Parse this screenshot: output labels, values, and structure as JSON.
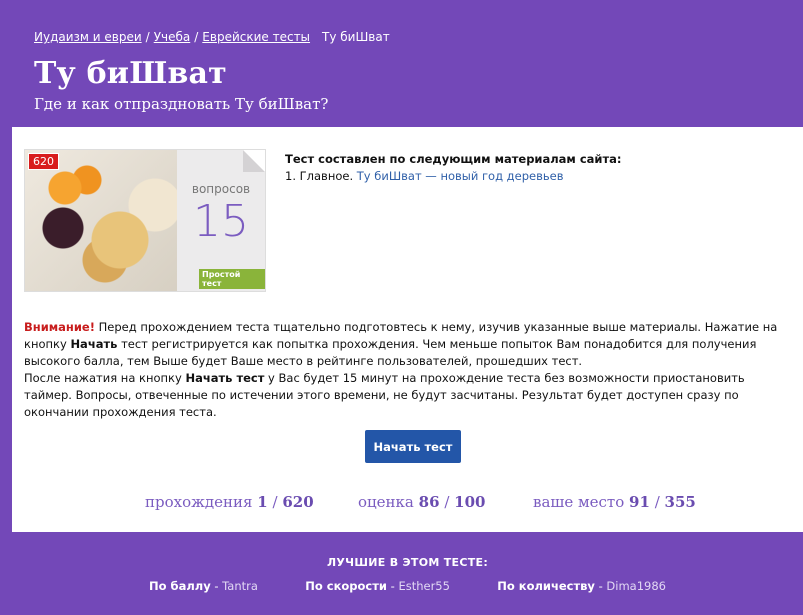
{
  "breadcrumb": {
    "items": [
      "Иудаизм и евреи",
      "Учеба",
      "Еврейские тесты"
    ],
    "current": "Ту биШват"
  },
  "page": {
    "title": "Ту биШват",
    "subtitle": "Где и как отпраздновать Ту биШват?"
  },
  "cover": {
    "badge": "620",
    "questions_word": "вопросов",
    "questions_count": "15",
    "level": "Простой тест"
  },
  "materials": {
    "heading": "Тест составлен по следующим материалам сайта:",
    "item_prefix": "1. Главное.",
    "item_link": "Ту биШват — новый год деревьев"
  },
  "notice": {
    "warn": "Внимание!",
    "p1_a": " Перед прохождением теста тщательно подготовтесь к нему, изучив указанные выше материалы. Нажатие на кнопку ",
    "p1_b": "Начать",
    "p1_c": " тест регистрируется как попытка прохождения. Чем меньше попыток Вам понадобится для получения высокого балла, тем Выше будет Ваше место в рейтинге пользователей, прошедших тест.",
    "p2_a": "После нажатия на кнопку ",
    "p2_b": "Начать тест",
    "p2_c": " у Вас будет 15 минут на прохождение теста без возможности приостановить таймер. Вопросы, отвеченные по истечении этого времени, не будут засчитаны. Результат будет доступен сразу по окончании прохождения теста."
  },
  "start_button": "Начать тест",
  "stats": {
    "attempts_label": "прохождения",
    "attempts_value": "1",
    "attempts_total": "620",
    "score_label": "оценка",
    "score_value": "86",
    "score_total": "100",
    "place_label": "ваше место",
    "place_value": "91",
    "place_total": "355",
    "sep": "/"
  },
  "best": {
    "title": "ЛУЧШИЕ В ЭТОМ ТЕСТЕ:",
    "by_score_label": "По баллу",
    "by_score_value": "Tantra",
    "by_speed_label": "По скорости",
    "by_speed_value": "Esther55",
    "by_count_label": "По количеству",
    "by_count_value": "Dima1986",
    "dash": " - "
  },
  "colors": {
    "brand_purple": "#7348b8",
    "button_blue": "#2356a8",
    "warning_red": "#c81d1d",
    "level_green": "#8ab43a",
    "badge_red": "#d81c1c"
  }
}
